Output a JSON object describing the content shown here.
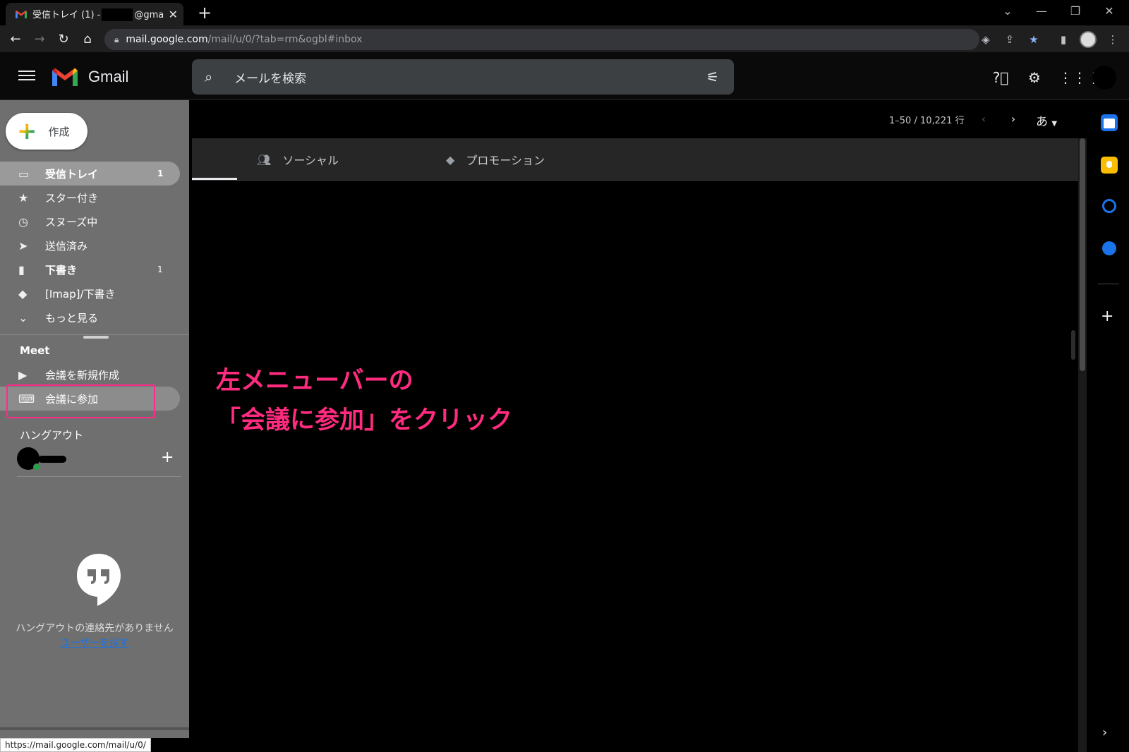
{
  "browser": {
    "tab_title_prefix": "受信トレイ (1) -",
    "tab_title_suffix": "@gmail.co",
    "url_host": "mail.google.com",
    "url_path": "/mail/u/0/?tab=rm&ogbl#inbox",
    "status_url": "https://mail.google.com/mail/u/0/"
  },
  "header": {
    "app_name": "Gmail",
    "search_placeholder": "メールを検索"
  },
  "sidebar": {
    "compose_label": "作成",
    "items": [
      {
        "label": "受信トレイ",
        "count": "1",
        "icon": "inbox-icon"
      },
      {
        "label": "スター付き",
        "count": "",
        "icon": "star-icon"
      },
      {
        "label": "スヌーズ中",
        "count": "",
        "icon": "clock-icon"
      },
      {
        "label": "送信済み",
        "count": "",
        "icon": "send-icon"
      },
      {
        "label": "下書き",
        "count": "1",
        "icon": "draft-icon"
      },
      {
        "label": "[Imap]/下書き",
        "count": "",
        "icon": "label-icon"
      },
      {
        "label": "もっと見る",
        "count": "",
        "icon": "chevron-down-icon"
      }
    ],
    "meet_heading": "Meet",
    "meet_items": [
      {
        "label": "会議を新規作成",
        "icon": "video-camera-icon"
      },
      {
        "label": "会議に参加",
        "icon": "keyboard-icon"
      }
    ],
    "hangouts_heading": "ハングアウト",
    "no_contacts": "ハングアウトの連絡先がありません",
    "find_users": "ユーザーを探す"
  },
  "main": {
    "pager": "1–50 / 10,221 行",
    "input_tool": "あ",
    "tabs": [
      {
        "label": "ソーシャル",
        "icon": "people-icon"
      },
      {
        "label": "プロモーション",
        "icon": "tag-icon"
      }
    ]
  },
  "annotation": {
    "line1": "左メニューバーの",
    "line2": "「会議に参加」をクリック",
    "color": "#ff2b7f"
  },
  "colors": {
    "sidebar_bg": "#6f6f6f",
    "highlight_border": "#ff2b8a",
    "link": "#1a73e8"
  }
}
